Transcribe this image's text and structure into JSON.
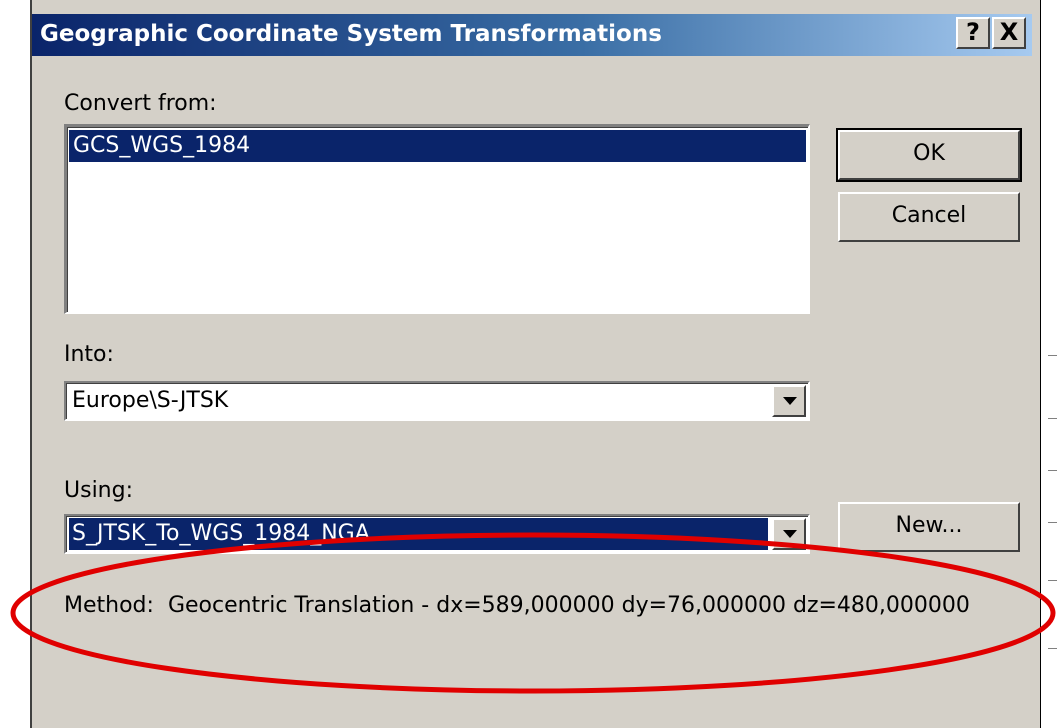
{
  "window": {
    "title": "Geographic Coordinate System Transformations",
    "help_button": "?",
    "close_button": "X"
  },
  "convert_from": {
    "label": "Convert from:",
    "items": [
      "GCS_WGS_1984"
    ],
    "selected_index": 0
  },
  "into": {
    "label": "Into:",
    "value": "Europe\\S-JTSK"
  },
  "using": {
    "label": "Using:",
    "value": "S_JTSK_To_WGS_1984_NGA"
  },
  "buttons": {
    "ok": "OK",
    "cancel": "Cancel",
    "new": "New..."
  },
  "method": {
    "label": "Method:",
    "value": "Geocentric Translation - dx=589,000000 dy=76,000000 dz=480,000000"
  },
  "colors": {
    "dialog_background": "#d4d0c8",
    "title_bar_start": "#0a246a",
    "selection": "#0a246a",
    "annotation_ellipse": "#e00000"
  },
  "icons": {
    "combo_arrow": "chevron-down-icon"
  }
}
